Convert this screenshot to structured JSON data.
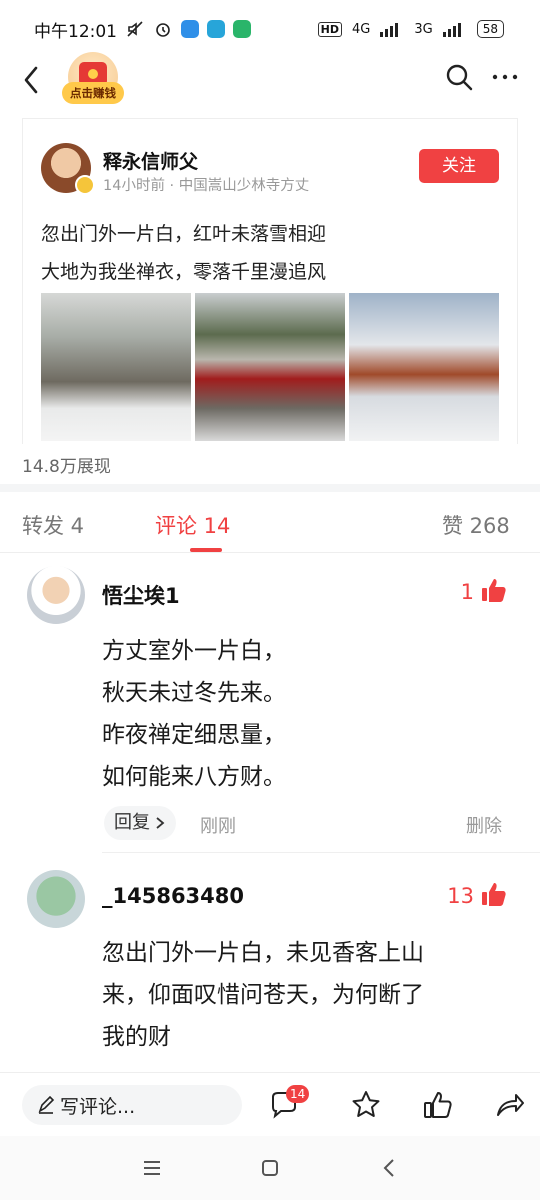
{
  "status_bar": {
    "time": "中午12:01",
    "network_4g": "4G",
    "network_3g": "3G",
    "battery": "58"
  },
  "nav": {
    "earn_label": "点击赚钱"
  },
  "post": {
    "author": "释永信师父",
    "meta": "14小时前 · 中国嵩山少林寺方丈",
    "follow_label": "关注",
    "lines": [
      "忽出门外一片白，红叶未落雪相迎",
      "大地为我坐禅衣，零落千里漫追风"
    ],
    "views": "14.8万展现"
  },
  "tabs": {
    "repost": "转发 4",
    "comment": "评论 14",
    "like": "赞 268"
  },
  "comments": [
    {
      "user": "悟尘埃1",
      "likes": "1",
      "lines": [
        "方丈室外一片白，",
        "秋天未过冬先来。",
        "昨夜禅定细思量，",
        "如何能来八方财。"
      ],
      "reply_label": "回复",
      "time": "刚刚",
      "delete_label": "删除"
    },
    {
      "user": "_145863480",
      "likes": "13",
      "lines": [
        "忽出门外一片白，未见香客上山",
        "来，仰面叹惜问苍天，为何断了",
        "我的财"
      ]
    }
  ],
  "bottom_bar": {
    "write_placeholder": "写评论...",
    "comment_count": "14"
  },
  "colors": {
    "accent": "#f04142",
    "muted": "#999999"
  }
}
